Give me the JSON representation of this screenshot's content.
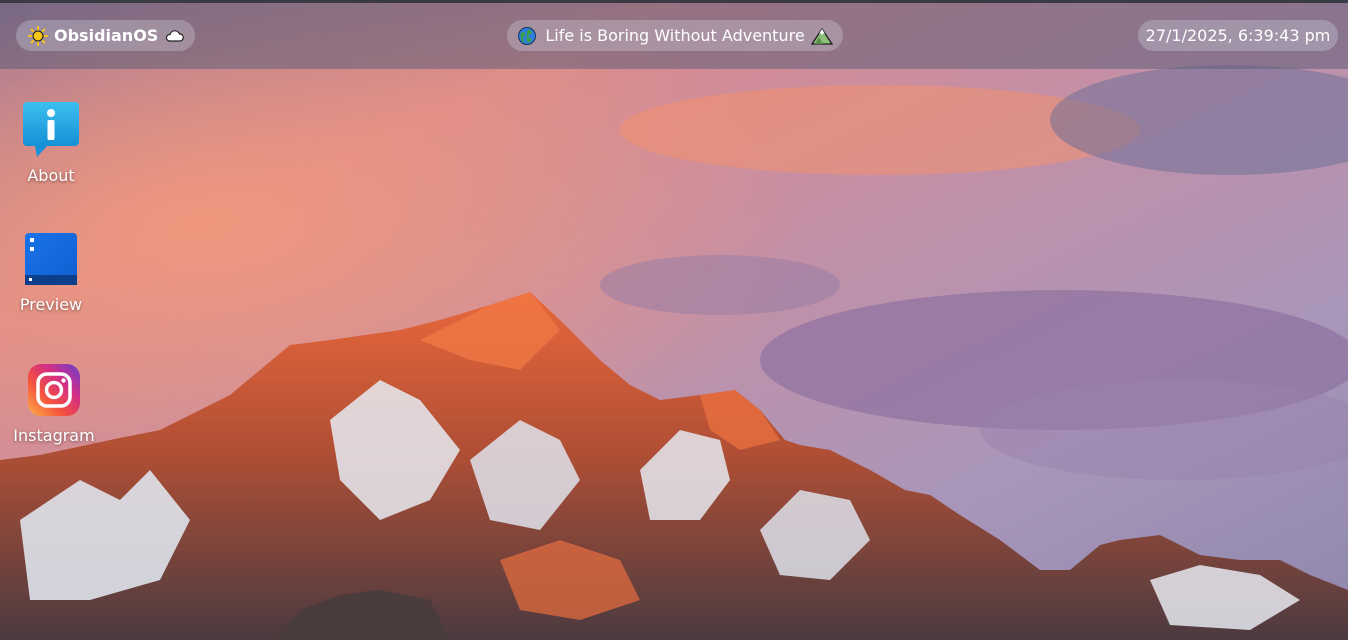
{
  "topbar": {
    "brand": "ObsidianOS",
    "brand_left_icon": "sun-icon",
    "brand_right_icon": "cloud-icon",
    "tagline": "Life is Boring Without Adventure",
    "tagline_left_icon": "globe-icon",
    "tagline_right_icon": "mountain-icon",
    "clock": "27/1/2025, 6:39:43 pm"
  },
  "desktop": {
    "icons": [
      {
        "label": "About",
        "icon": "info-bubble-icon"
      },
      {
        "label": "Preview",
        "icon": "preview-window-icon"
      },
      {
        "label": "Instagram",
        "icon": "instagram-icon"
      }
    ]
  },
  "wallpaper": {
    "subject": "mountain-sunset",
    "colors": {
      "sky_top": "#7c7aa6",
      "sky_glow": "#f28a6e",
      "rock_lit": "#e0643a",
      "snow": "#e9ecf3"
    }
  }
}
